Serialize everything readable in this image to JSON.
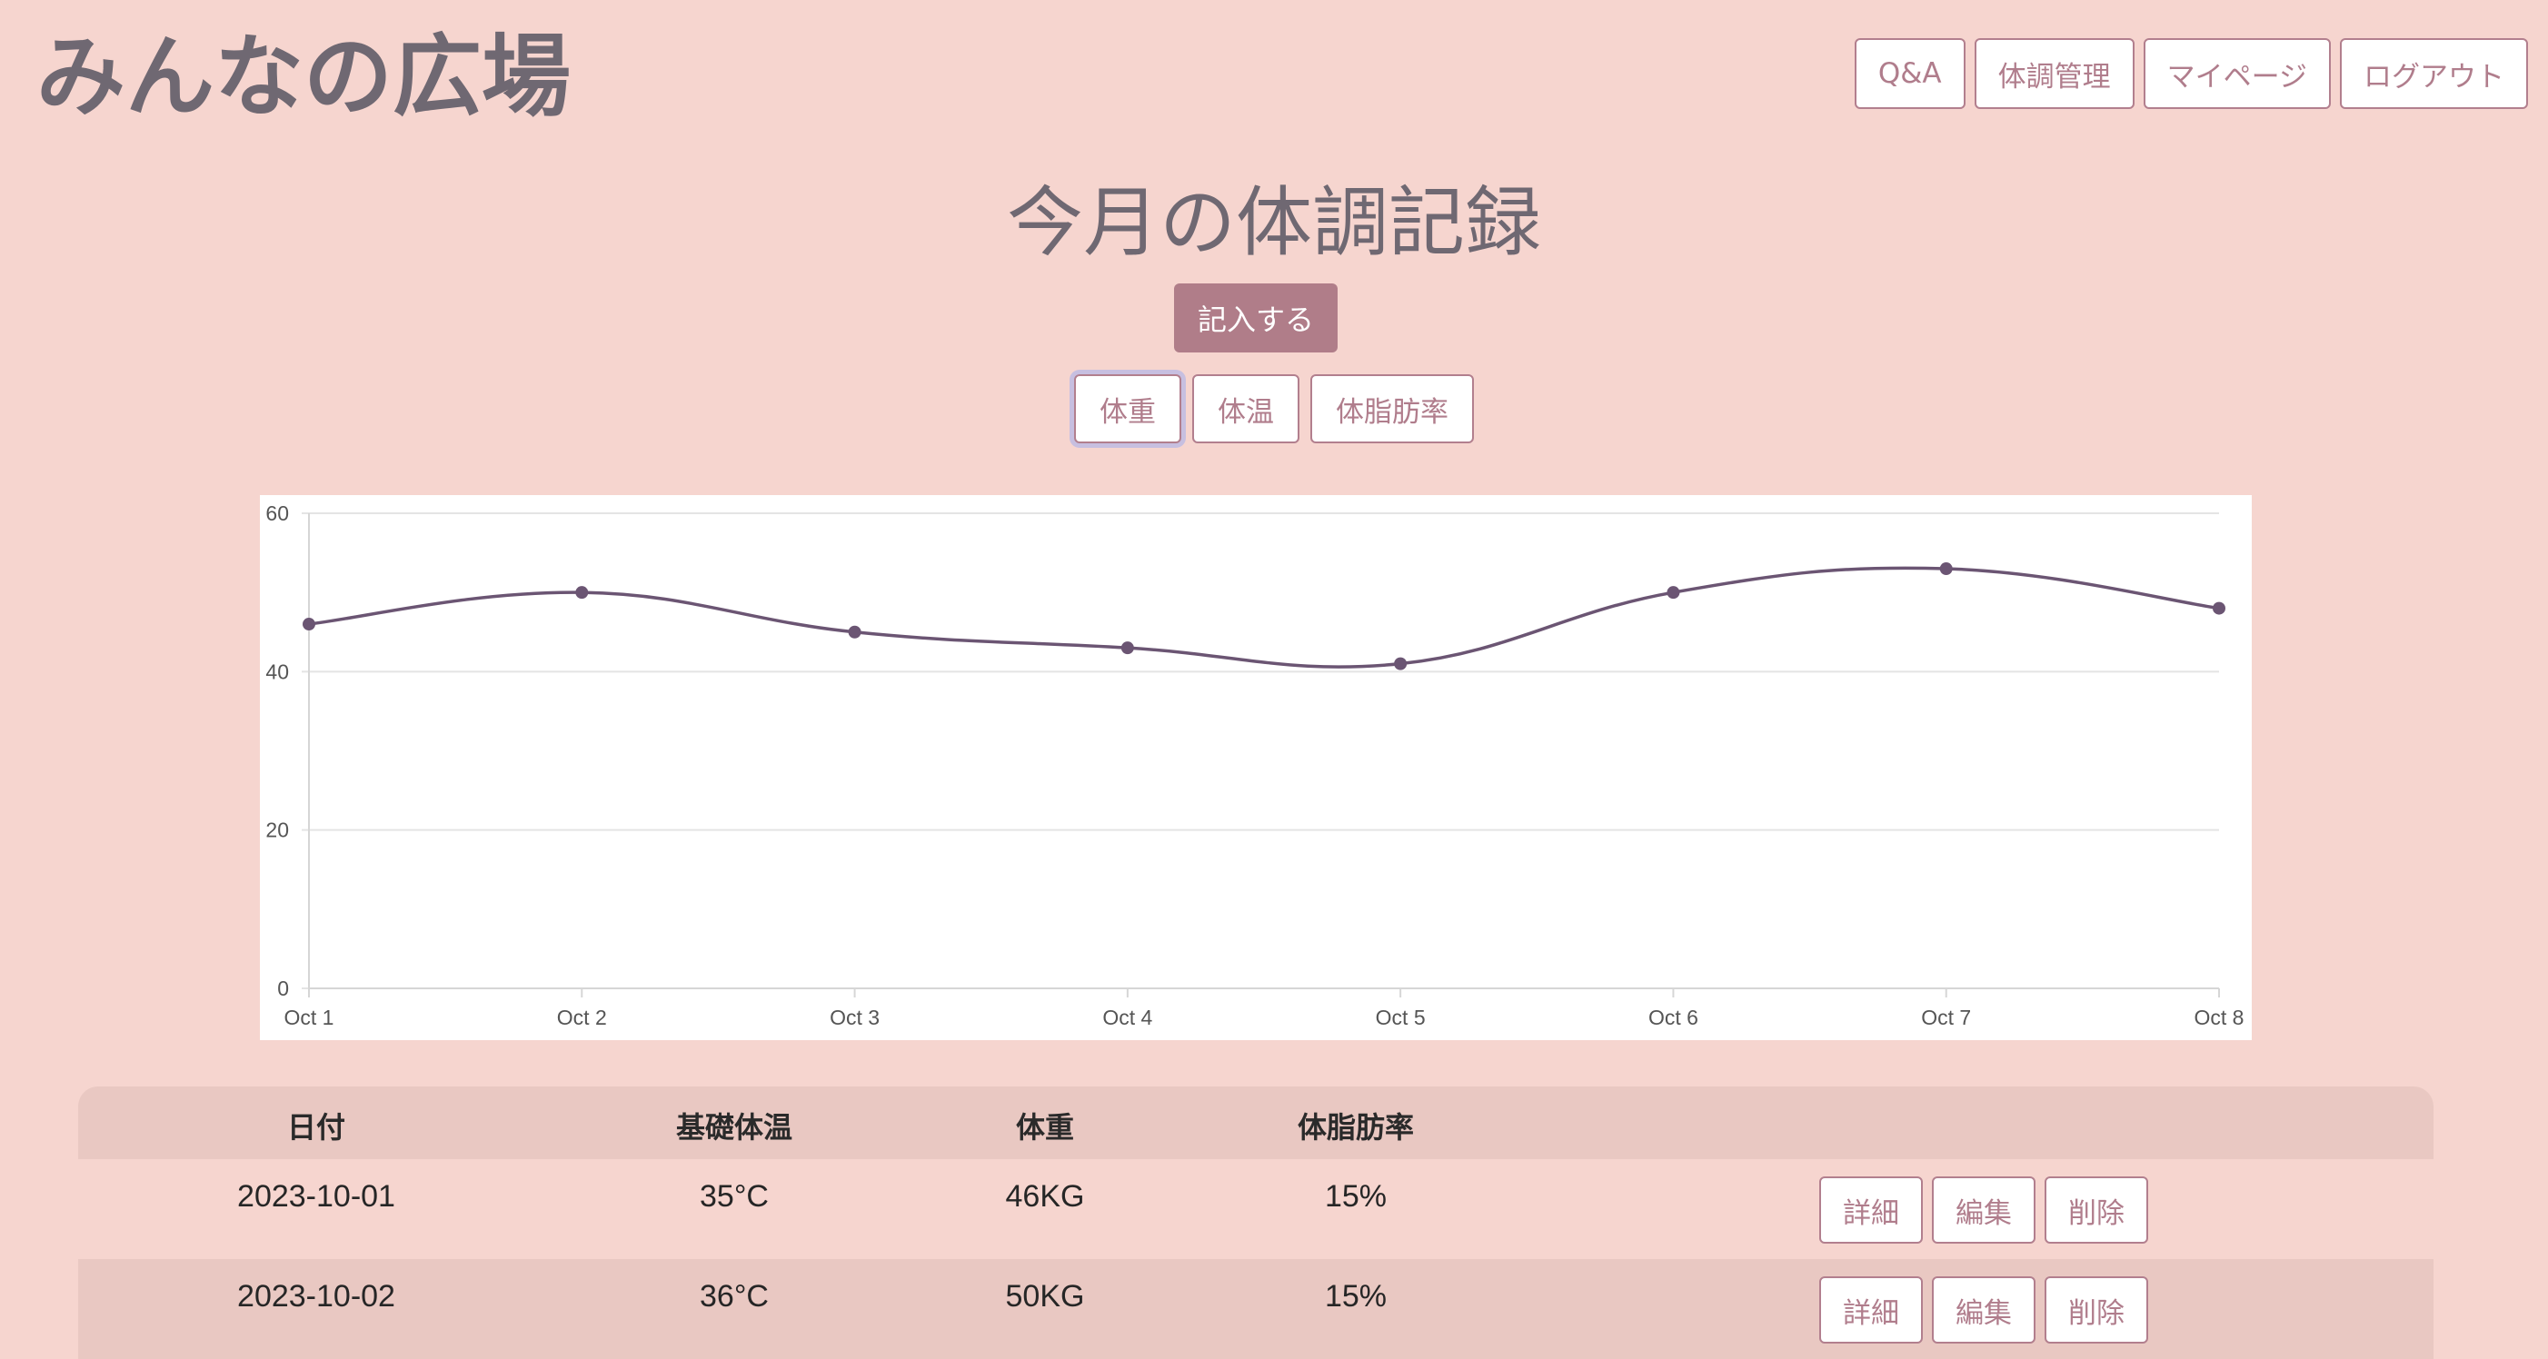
{
  "header": {
    "site_title": "みんなの広場",
    "nav": [
      {
        "label": "Q&A"
      },
      {
        "label": "体調管理"
      },
      {
        "label": "マイページ"
      },
      {
        "label": "ログアウト"
      }
    ]
  },
  "main": {
    "title": "今月の体調記録",
    "entry_button": "記入する",
    "metric_tabs": [
      {
        "label": "体重",
        "active": true
      },
      {
        "label": "体温",
        "active": false
      },
      {
        "label": "体脂肪率",
        "active": false
      }
    ]
  },
  "chart_data": {
    "type": "line",
    "categories": [
      "Oct 1",
      "Oct 2",
      "Oct 3",
      "Oct 4",
      "Oct 5",
      "Oct 6",
      "Oct 7",
      "Oct 8"
    ],
    "series": [
      {
        "values": [
          46,
          50,
          45,
          43,
          41,
          50,
          53,
          48
        ]
      }
    ],
    "ylim": [
      0,
      60
    ],
    "yticks": [
      0,
      20,
      40,
      60
    ],
    "grid": true,
    "smooth": true,
    "line_color": "#6b5573"
  },
  "table": {
    "headers": [
      "日付",
      "基礎体温",
      "体重",
      "体脂肪率"
    ],
    "rows": [
      [
        "2023-10-01",
        "35°C",
        "46KG",
        "15%"
      ],
      [
        "2023-10-02",
        "36°C",
        "50KG",
        "15%"
      ]
    ],
    "row_actions": [
      "詳細",
      "編集",
      "削除"
    ]
  }
}
